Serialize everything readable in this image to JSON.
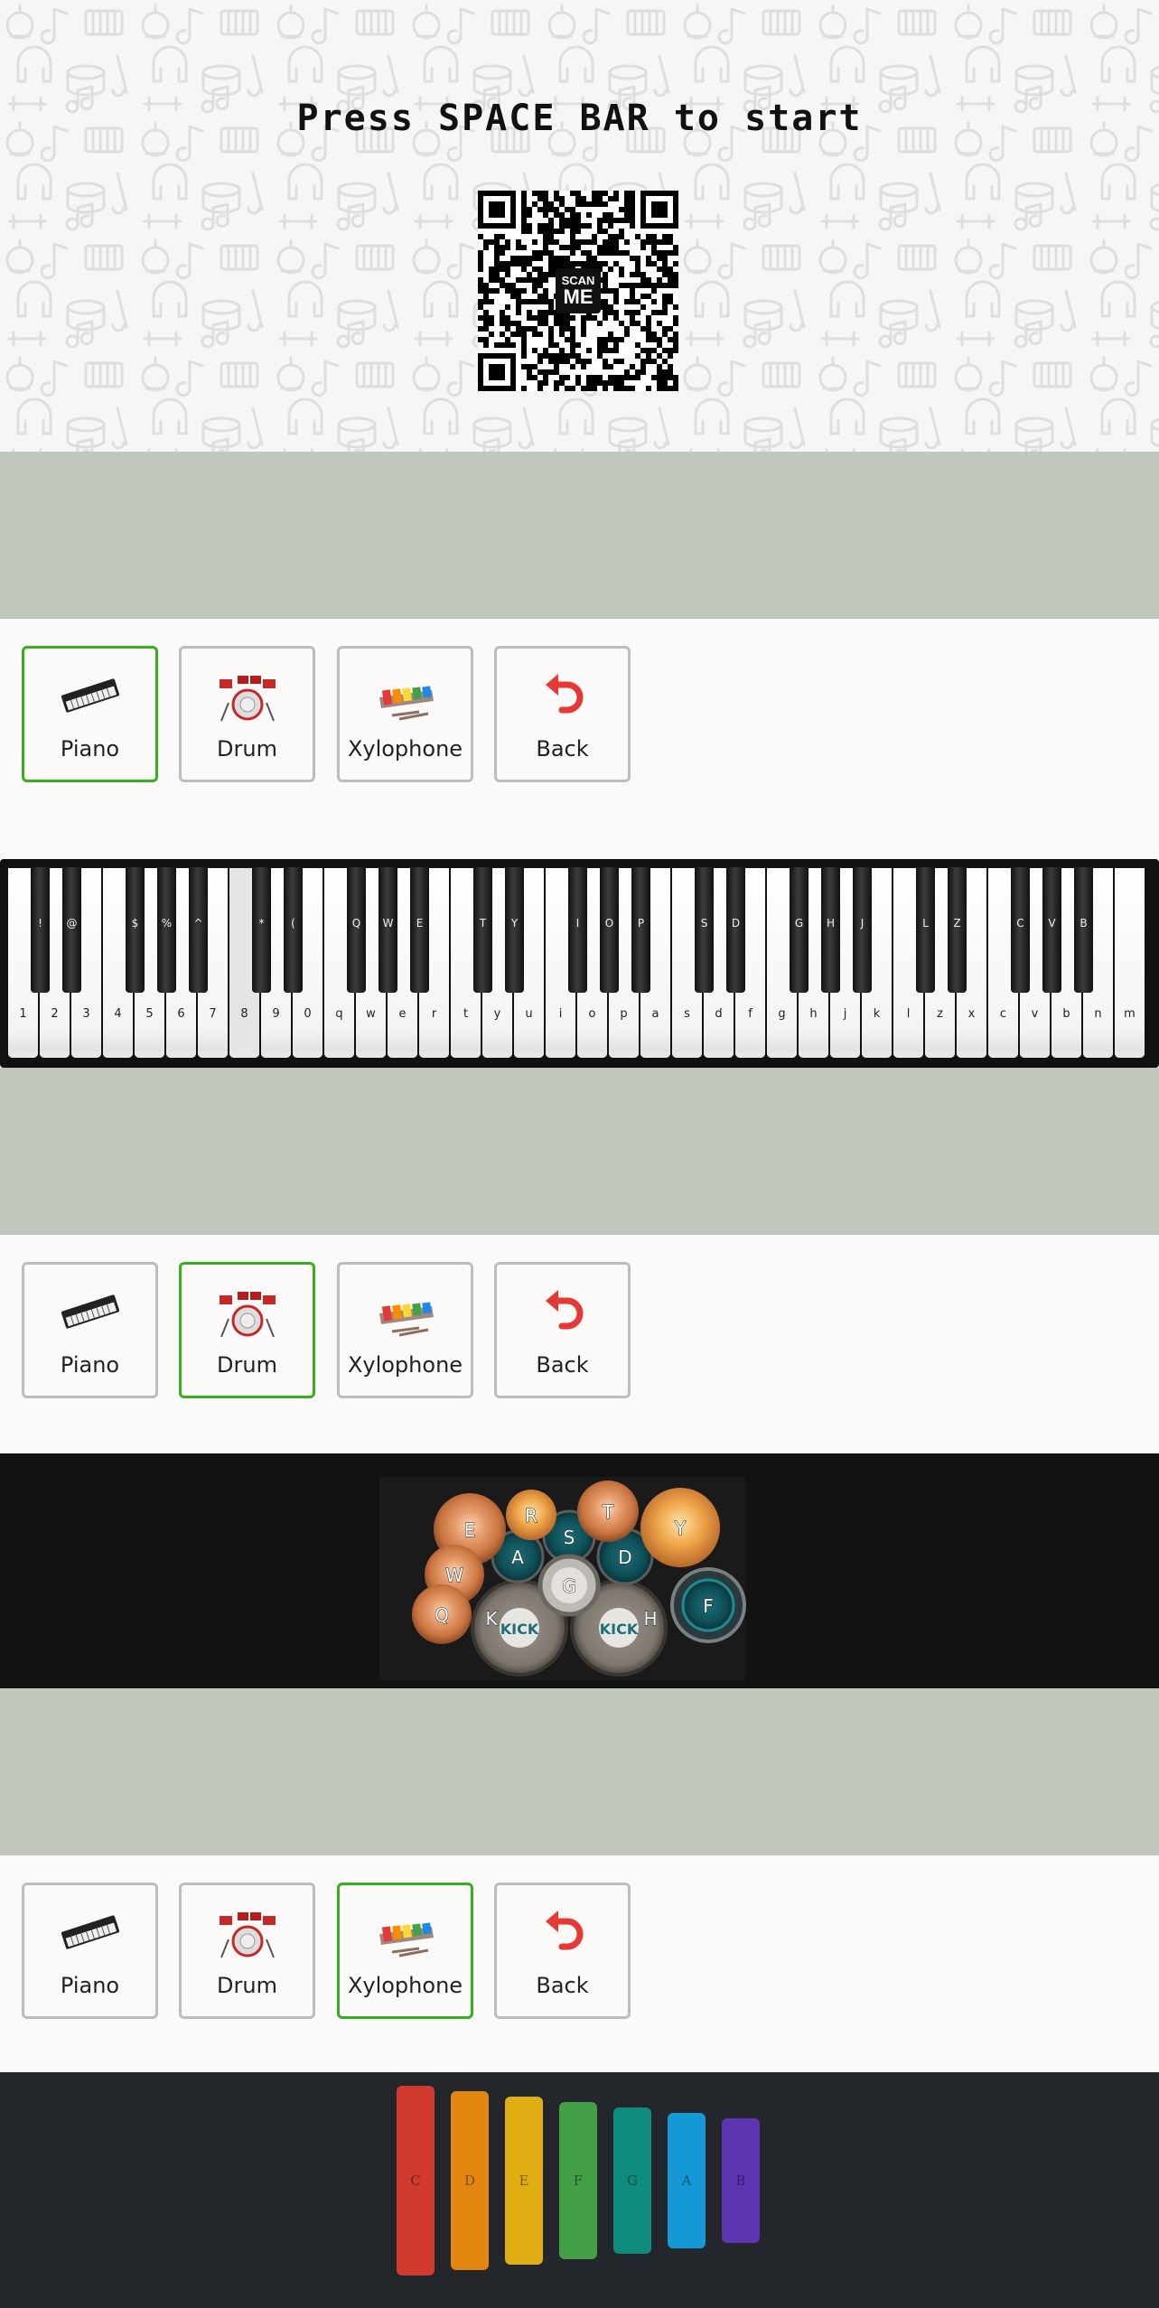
{
  "hero": {
    "title": "Press SPACE BAR to start",
    "qr": {
      "badge_line1": "SCAN",
      "badge_line2": "ME"
    }
  },
  "menus": [
    {
      "selected": "Piano",
      "buttons": [
        {
          "label": "Piano",
          "icon": "piano-icon"
        },
        {
          "label": "Drum",
          "icon": "drum-icon"
        },
        {
          "label": "Xylophone",
          "icon": "xylophone-icon"
        },
        {
          "label": "Back",
          "icon": "back-arrow-icon"
        }
      ]
    },
    {
      "selected": "Drum",
      "buttons": [
        {
          "label": "Piano",
          "icon": "piano-icon"
        },
        {
          "label": "Drum",
          "icon": "drum-icon"
        },
        {
          "label": "Xylophone",
          "icon": "xylophone-icon"
        },
        {
          "label": "Back",
          "icon": "back-arrow-icon"
        }
      ]
    },
    {
      "selected": "Xylophone",
      "buttons": [
        {
          "label": "Piano",
          "icon": "piano-icon"
        },
        {
          "label": "Drum",
          "icon": "drum-icon"
        },
        {
          "label": "Xylophone",
          "icon": "xylophone-icon"
        },
        {
          "label": "Back",
          "icon": "back-arrow-icon"
        }
      ]
    }
  ],
  "piano": {
    "white_keys": [
      "1",
      "2",
      "3",
      "4",
      "5",
      "6",
      "7",
      "8",
      "9",
      "0",
      "q",
      "w",
      "e",
      "r",
      "t",
      "y",
      "u",
      "i",
      "o",
      "p",
      "a",
      "s",
      "d",
      "f",
      "g",
      "h",
      "j",
      "k",
      "l",
      "z",
      "x",
      "c",
      "v",
      "b",
      "n",
      "m"
    ],
    "black_keys": [
      "!",
      "@",
      "$",
      "%",
      "^",
      "*",
      "(",
      "Q",
      "W",
      "E",
      "T",
      "Y",
      "I",
      "O",
      "P",
      "S",
      "D",
      "G",
      "H",
      "J",
      "L",
      "Z",
      "C",
      "V",
      "B"
    ],
    "active_key": "8"
  },
  "drums": {
    "pads": [
      {
        "key": "E",
        "name": ""
      },
      {
        "key": "R",
        "name": ""
      },
      {
        "key": "T",
        "name": ""
      },
      {
        "key": "Y",
        "name": ""
      },
      {
        "key": "W",
        "name": ""
      },
      {
        "key": "Q",
        "name": ""
      },
      {
        "key": "A",
        "name": ""
      },
      {
        "key": "S",
        "name": ""
      },
      {
        "key": "D",
        "name": ""
      },
      {
        "key": "G",
        "name": ""
      },
      {
        "key": "F",
        "name": ""
      },
      {
        "key": "K",
        "name": "KICK"
      },
      {
        "key": "H",
        "name": "KICK"
      }
    ]
  },
  "xylophone": {
    "bars": [
      {
        "note": "C",
        "color": "#d13a2e"
      },
      {
        "note": "D",
        "color": "#e2870f"
      },
      {
        "note": "E",
        "color": "#e0ae12"
      },
      {
        "note": "F",
        "color": "#43a047"
      },
      {
        "note": "G",
        "color": "#0f8c7e"
      },
      {
        "note": "A",
        "color": "#1598d6"
      },
      {
        "note": "B",
        "color": "#5e35b1"
      }
    ]
  },
  "colors": {
    "accent_selected": "#38ad1d",
    "band": "#c0c8bd",
    "back_arrow": "#e53935"
  }
}
